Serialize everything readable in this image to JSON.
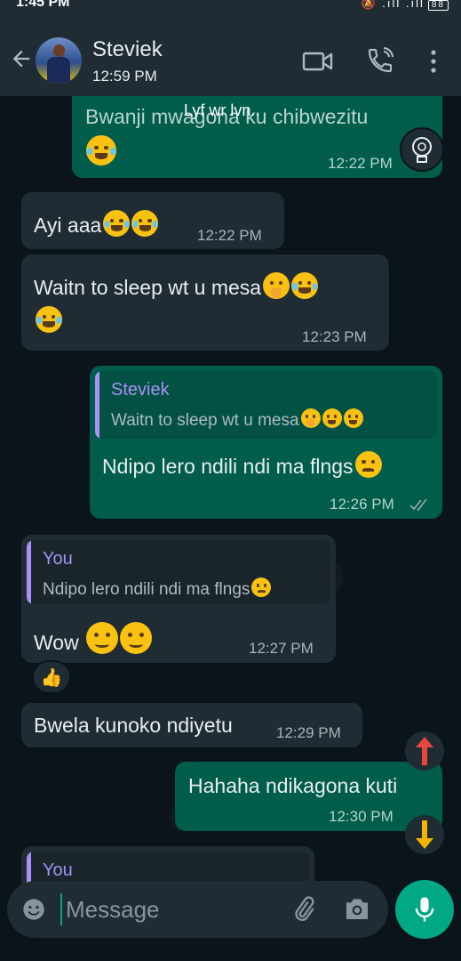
{
  "status_bar": {
    "time": "1:45 PM",
    "battery": "88"
  },
  "header": {
    "contact_name": "Steviek",
    "last_seen": "12:59 PM"
  },
  "messages": [
    {
      "direction": "out",
      "overlay_text": "Lyf wr lvn..",
      "text": "Bwanji mwagona ku chibwezitu",
      "time": "12:22 PM"
    },
    {
      "direction": "in",
      "text": "Ayi aaa",
      "time": "12:22 PM"
    },
    {
      "direction": "in",
      "text": "Waitn to sleep  wt u mesa",
      "time": "12:23 PM"
    },
    {
      "direction": "out",
      "quote_author": "Steviek",
      "quote_text": "Waitn to sleep  wt u mesa",
      "text": "Ndipo lero ndili ndi ma flngs",
      "time": "12:26 PM"
    },
    {
      "direction": "in",
      "quote_author": "You",
      "quote_text": "Ndipo lero ndili ndi ma flngs",
      "text": "Wow",
      "time": "12:27 PM",
      "reaction": "👍"
    },
    {
      "direction": "in",
      "text": "Bwela kunoko ndiyetu",
      "time": "12:29 PM"
    },
    {
      "direction": "out",
      "text": "Hahaha ndikagona kuti",
      "time": "12:30 PM"
    },
    {
      "direction": "in",
      "quote_author": "You"
    }
  ],
  "input": {
    "placeholder": "Message"
  },
  "icons": [
    "back-arrow-icon",
    "video-call-icon",
    "voice-call-icon",
    "more-options-icon",
    "emoji-icon",
    "attach-icon",
    "camera-icon",
    "mic-icon",
    "scroll-up-icon",
    "scroll-down-icon"
  ],
  "colors": {
    "incoming": "#202c33",
    "outgoing": "#005c4b",
    "accent": "#00a884",
    "quote_author": "#a791f5"
  }
}
